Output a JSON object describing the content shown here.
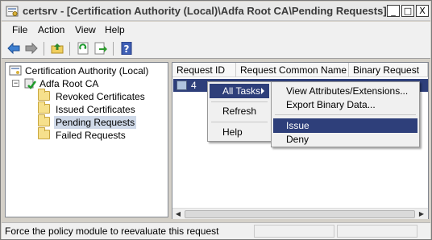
{
  "window": {
    "title": "certsrv - [Certification Authority (Local)\\Adfa Root CA\\Pending Requests]",
    "controls": {
      "minimize": "_",
      "maximize": "□",
      "close": "X"
    }
  },
  "menubar": {
    "items": [
      "File",
      "Action",
      "View",
      "Help"
    ]
  },
  "toolbar": {
    "icons": [
      "back-arrow-icon",
      "forward-arrow-icon",
      "up-folder-icon",
      "refresh-icon",
      "export-icon",
      "help-icon"
    ]
  },
  "tree": {
    "root": "Certification Authority (Local)",
    "ca": "Adfa Root CA",
    "folders": [
      "Revoked Certificates",
      "Issued Certificates",
      "Pending Requests",
      "Failed Requests"
    ],
    "selected": "Pending Requests"
  },
  "list": {
    "columns": [
      "Request ID",
      "Request Common Name",
      "Binary Request"
    ],
    "rows": [
      {
        "request_id": "4"
      }
    ]
  },
  "context_menu": {
    "items": [
      "All Tasks",
      "Refresh",
      "Help"
    ]
  },
  "submenu": {
    "items": [
      "View Attributes/Extensions...",
      "Export Binary Data...",
      "Issue",
      "Deny"
    ],
    "highlighted": "Issue"
  },
  "status": {
    "text": "Force the policy module to reevaluate this request"
  },
  "colors": {
    "selection": "#2e3f7a",
    "tree_selection": "#cfd9e8"
  }
}
